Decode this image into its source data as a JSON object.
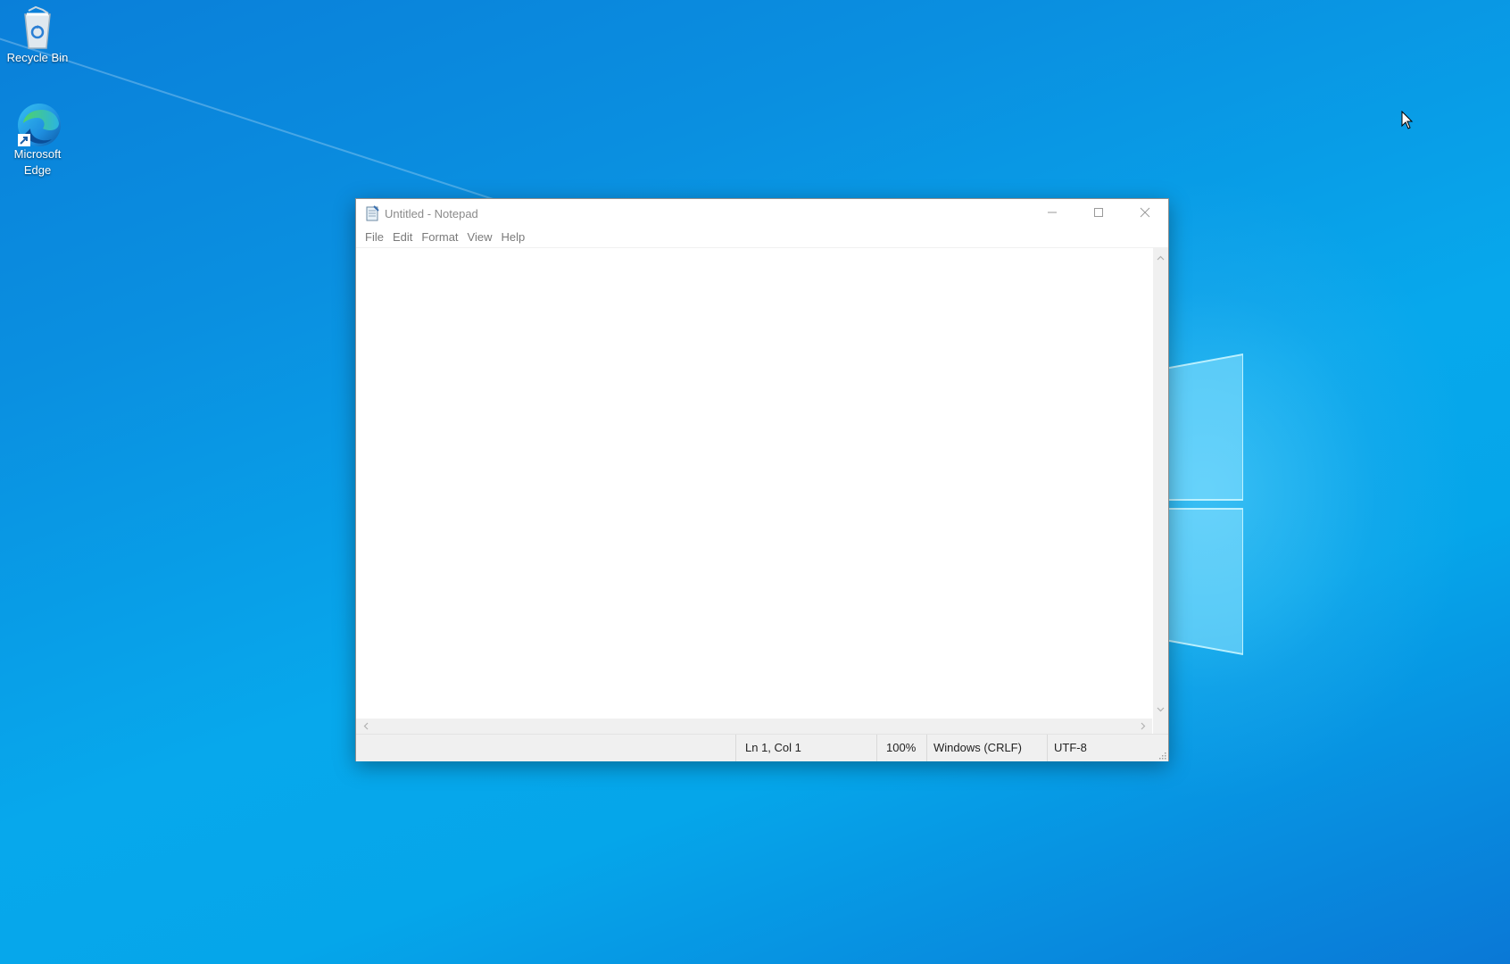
{
  "desktop": {
    "icons": [
      {
        "label": "Recycle Bin",
        "icon": "recycle-bin-icon"
      },
      {
        "label": "Microsoft Edge",
        "icon": "edge-icon"
      }
    ]
  },
  "window": {
    "title": "Untitled - Notepad",
    "app_icon": "notepad-icon",
    "caption_buttons": [
      "minimize-icon",
      "maximize-icon",
      "close-icon"
    ],
    "menu": [
      "File",
      "Edit",
      "Format",
      "View",
      "Help"
    ],
    "editor_text": "",
    "status": {
      "position": "Ln 1, Col 1",
      "zoom": "100%",
      "line_ending": "Windows (CRLF)",
      "encoding": "UTF-8"
    }
  },
  "colors": {
    "desktop_blue": "#0a8fe0",
    "window_bg": "#ffffff",
    "statusbar_bg": "#f0f0f0"
  }
}
